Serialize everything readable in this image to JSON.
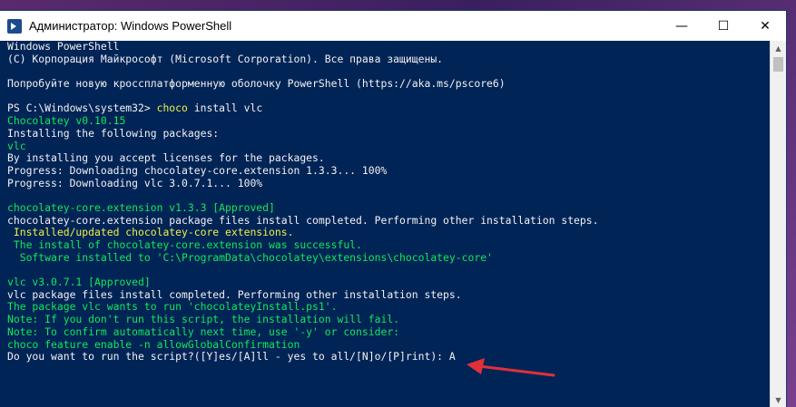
{
  "window": {
    "title": "Администратор: Windows PowerShell",
    "minimize": "—",
    "maximize": "☐",
    "close": "✕"
  },
  "console": {
    "lines": [
      {
        "text": "Windows PowerShell",
        "color": "white"
      },
      {
        "text": "(C) Корпорация Майкрософт (Microsoft Corporation). Все права защищены.",
        "color": "white"
      },
      {
        "text": "",
        "color": "white"
      },
      {
        "text": "Попробуйте новую кроссплатформенную оболочку PowerShell (https://aka.ms/pscore6)",
        "color": "white"
      },
      {
        "text": "",
        "color": "white"
      },
      {
        "prompt": "PS C:\\Windows\\system32> ",
        "cmd": "choco",
        "args": " install vlc"
      },
      {
        "text": "Chocolatey v0.10.15",
        "color": "green"
      },
      {
        "text": "Installing the following packages:",
        "color": "white"
      },
      {
        "text": "vlc",
        "color": "green"
      },
      {
        "text": "By installing you accept licenses for the packages.",
        "color": "white"
      },
      {
        "text": "Progress: Downloading chocolatey-core.extension 1.3.3... 100%",
        "color": "white"
      },
      {
        "text": "Progress: Downloading vlc 3.0.7.1... 100%",
        "color": "white"
      },
      {
        "text": "",
        "color": "white"
      },
      {
        "text": "chocolatey-core.extension v1.3.3 [Approved]",
        "color": "green"
      },
      {
        "text": "chocolatey-core.extension package files install completed. Performing other installation steps.",
        "color": "white"
      },
      {
        "text": " Installed/updated chocolatey-core extensions.",
        "color": "yellow"
      },
      {
        "text": " The install of chocolatey-core.extension was successful.",
        "color": "green"
      },
      {
        "text": "  Software installed to 'C:\\ProgramData\\chocolatey\\extensions\\chocolatey-core'",
        "color": "green"
      },
      {
        "text": "",
        "color": "white"
      },
      {
        "text": "vlc v3.0.7.1 [Approved]",
        "color": "green"
      },
      {
        "text": "vlc package files install completed. Performing other installation steps.",
        "color": "white"
      },
      {
        "text": "The package vlc wants to run 'chocolateyInstall.ps1'.",
        "color": "green"
      },
      {
        "text": "Note: If you don't run this script, the installation will fail.",
        "color": "green"
      },
      {
        "text": "Note: To confirm automatically next time, use '-y' or consider:",
        "color": "green"
      },
      {
        "text": "choco feature enable -n allowGlobalConfirmation",
        "color": "green"
      },
      {
        "text": "Do you want to run the script?([Y]es/[A]ll - yes to all/[N]o/[P]rint): A",
        "color": "white"
      }
    ]
  },
  "scrollbar": {
    "up": "▲",
    "down": "▼"
  },
  "colors": {
    "background": "#012456",
    "green": "#13e85a",
    "yellow": "#f0f04a",
    "arrow": "#e0303a"
  }
}
